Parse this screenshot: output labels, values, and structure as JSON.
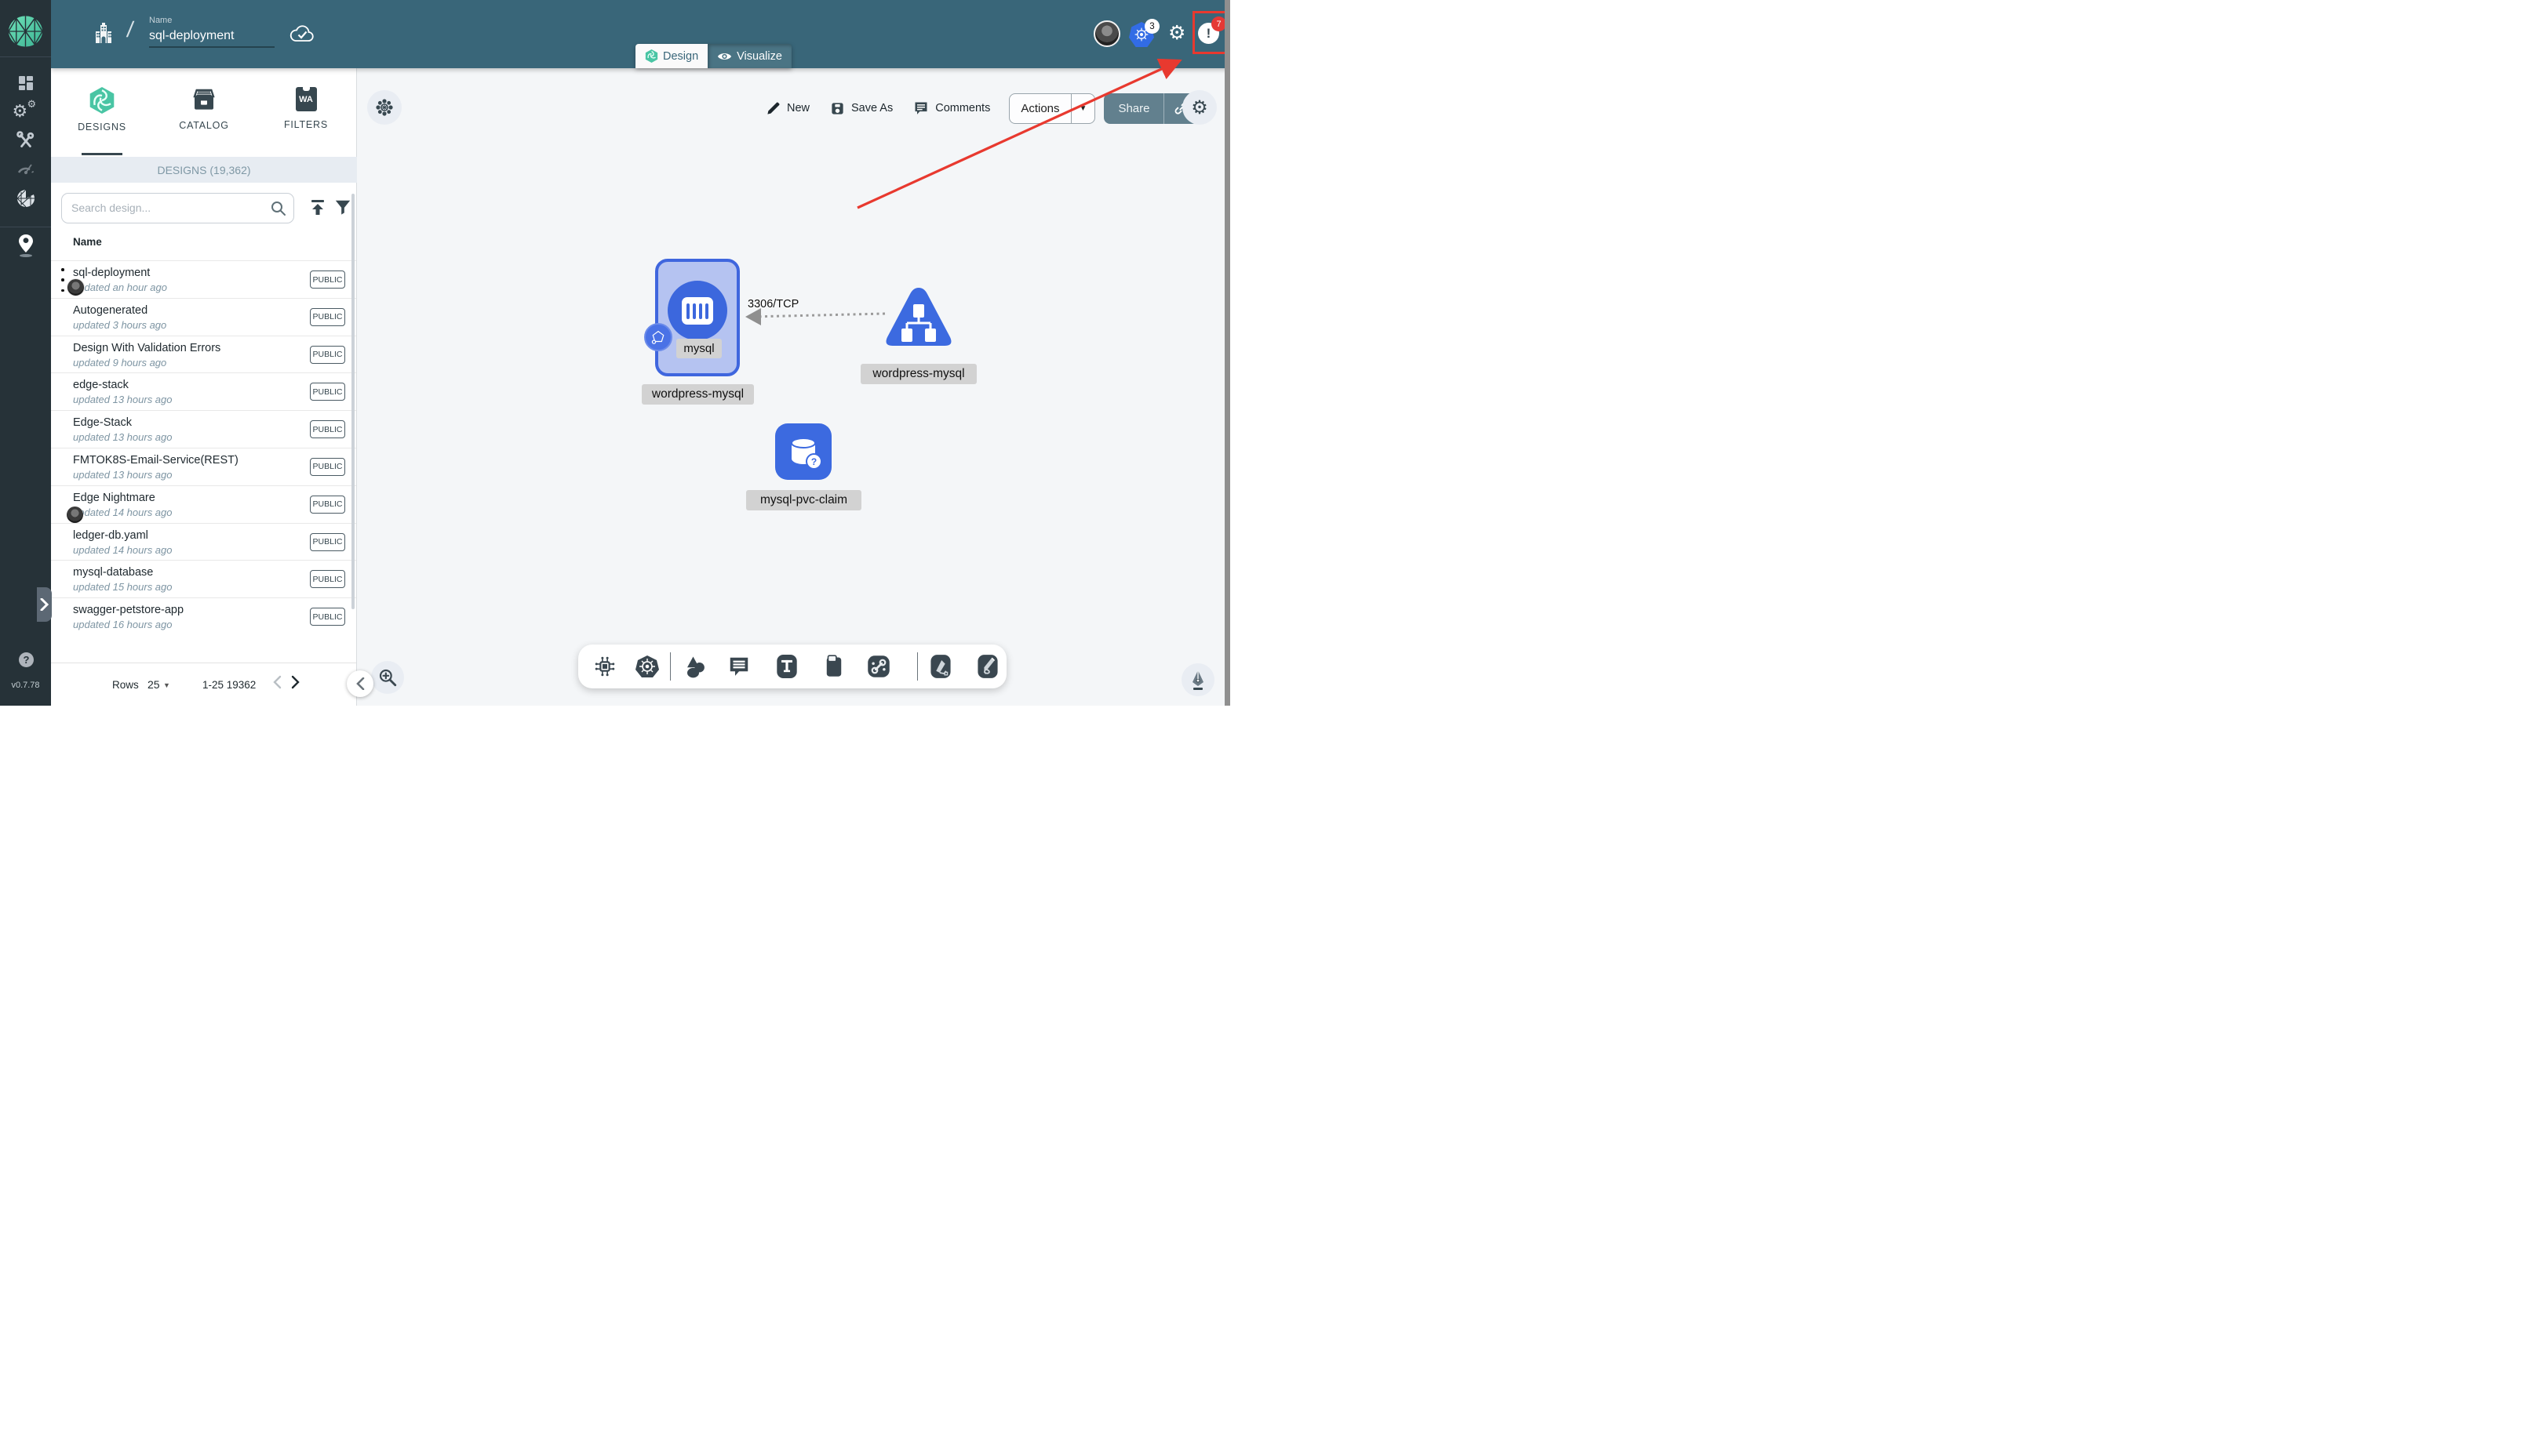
{
  "app": {
    "version": "v0.7.78"
  },
  "header": {
    "breadcrumb_separator": "/",
    "name_field": {
      "label": "Name",
      "value": "sql-deployment"
    },
    "mode_tabs": {
      "design": "Design",
      "visualize": "Visualize"
    },
    "kubernetes_context_count": "3",
    "notification_count": "7"
  },
  "left_panel": {
    "tabs": {
      "designs": "DESIGNS",
      "catalog": "CATALOG",
      "filters": "FILTERS"
    },
    "count_header": "DESIGNS (19,362)",
    "search": {
      "placeholder": "Search design..."
    },
    "columns": {
      "name": "Name"
    },
    "rows": [
      {
        "name": "sql-deployment",
        "updated": "updated an hour ago",
        "visibility": "PUBLIC"
      },
      {
        "name": "Autogenerated",
        "updated": "updated 3 hours ago",
        "visibility": "PUBLIC"
      },
      {
        "name": "Design With Validation Errors",
        "updated": "updated 9 hours ago",
        "visibility": "PUBLIC"
      },
      {
        "name": "edge-stack",
        "updated": "updated 13 hours ago",
        "visibility": "PUBLIC"
      },
      {
        "name": "Edge-Stack",
        "updated": "updated 13 hours ago",
        "visibility": "PUBLIC"
      },
      {
        "name": "FMTOK8S-Email-Service(REST)",
        "updated": "updated 13 hours ago",
        "visibility": "PUBLIC"
      },
      {
        "name": "Edge Nightmare",
        "updated": "updated 14 hours ago",
        "visibility": "PUBLIC"
      },
      {
        "name": "ledger-db.yaml",
        "updated": "updated 14 hours ago",
        "visibility": "PUBLIC"
      },
      {
        "name": "mysql-database",
        "updated": "updated 15 hours ago",
        "visibility": "PUBLIC"
      },
      {
        "name": "swagger-petstore-app",
        "updated": "updated 16 hours ago",
        "visibility": "PUBLIC"
      }
    ],
    "pagination": {
      "rows_label": "Rows",
      "per_page": "25",
      "range": "1-25 19362"
    }
  },
  "canvas": {
    "toolbar": {
      "new": "New",
      "save_as": "Save As",
      "comments": "Comments",
      "actions": "Actions",
      "share": "Share"
    },
    "edge": {
      "label": "3306/TCP"
    },
    "nodes": {
      "deployment": {
        "inner_label": "mysql",
        "label": "wordpress-mysql"
      },
      "service": {
        "label": "wordpress-mysql"
      },
      "volume": {
        "label": "mysql-pvc-claim"
      }
    }
  },
  "colors": {
    "primary": "#396679",
    "accent_red": "#e8392f",
    "node_blue": "#3c6ae0",
    "k8s_blue": "#326ce5"
  }
}
